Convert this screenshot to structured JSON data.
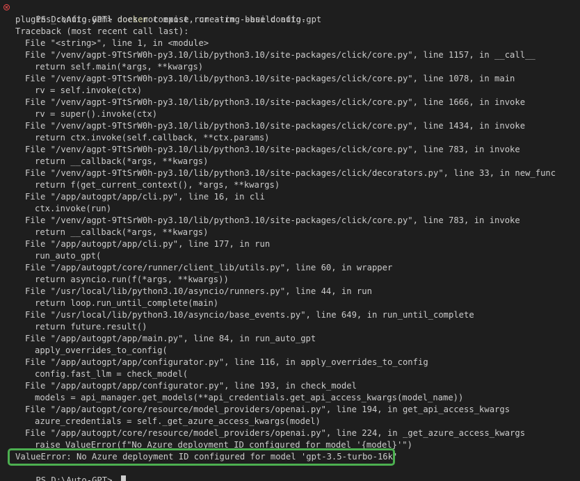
{
  "prompt": {
    "text": "PS D:\\Auto-GPT> ",
    "command": "docker",
    "args": " compose run --rm --build auto-gpt"
  },
  "lines": [
    {
      "indent": 0,
      "text": "plugins_config.yaml does not exist, creating base config."
    },
    {
      "indent": 0,
      "text": "Traceback (most recent call last):"
    },
    {
      "indent": 1,
      "text": "File \"<string>\", line 1, in <module>"
    },
    {
      "indent": 1,
      "text": "File \"/venv/agpt-9TtSrW0h-py3.10/lib/python3.10/site-packages/click/core.py\", line 1157, in __call__"
    },
    {
      "indent": 2,
      "text": "return self.main(*args, **kwargs)"
    },
    {
      "indent": 1,
      "text": "File \"/venv/agpt-9TtSrW0h-py3.10/lib/python3.10/site-packages/click/core.py\", line 1078, in main"
    },
    {
      "indent": 2,
      "text": "rv = self.invoke(ctx)"
    },
    {
      "indent": 1,
      "text": "File \"/venv/agpt-9TtSrW0h-py3.10/lib/python3.10/site-packages/click/core.py\", line 1666, in invoke"
    },
    {
      "indent": 2,
      "text": "rv = super().invoke(ctx)"
    },
    {
      "indent": 1,
      "text": "File \"/venv/agpt-9TtSrW0h-py3.10/lib/python3.10/site-packages/click/core.py\", line 1434, in invoke"
    },
    {
      "indent": 2,
      "text": "return ctx.invoke(self.callback, **ctx.params)"
    },
    {
      "indent": 1,
      "text": "File \"/venv/agpt-9TtSrW0h-py3.10/lib/python3.10/site-packages/click/core.py\", line 783, in invoke"
    },
    {
      "indent": 2,
      "text": "return __callback(*args, **kwargs)"
    },
    {
      "indent": 1,
      "text": "File \"/venv/agpt-9TtSrW0h-py3.10/lib/python3.10/site-packages/click/decorators.py\", line 33, in new_func"
    },
    {
      "indent": 2,
      "text": "return f(get_current_context(), *args, **kwargs)"
    },
    {
      "indent": 1,
      "text": "File \"/app/autogpt/app/cli.py\", line 16, in cli"
    },
    {
      "indent": 2,
      "text": "ctx.invoke(run)"
    },
    {
      "indent": 1,
      "text": "File \"/venv/agpt-9TtSrW0h-py3.10/lib/python3.10/site-packages/click/core.py\", line 783, in invoke"
    },
    {
      "indent": 2,
      "text": "return __callback(*args, **kwargs)"
    },
    {
      "indent": 1,
      "text": "File \"/app/autogpt/app/cli.py\", line 177, in run"
    },
    {
      "indent": 2,
      "text": "run_auto_gpt("
    },
    {
      "indent": 1,
      "text": "File \"/app/autogpt/core/runner/client_lib/utils.py\", line 60, in wrapper"
    },
    {
      "indent": 2,
      "text": "return asyncio.run(f(*args, **kwargs))"
    },
    {
      "indent": 1,
      "text": "File \"/usr/local/lib/python3.10/asyncio/runners.py\", line 44, in run"
    },
    {
      "indent": 2,
      "text": "return loop.run_until_complete(main)"
    },
    {
      "indent": 1,
      "text": "File \"/usr/local/lib/python3.10/asyncio/base_events.py\", line 649, in run_until_complete"
    },
    {
      "indent": 2,
      "text": "return future.result()"
    },
    {
      "indent": 1,
      "text": "File \"/app/autogpt/app/main.py\", line 84, in run_auto_gpt"
    },
    {
      "indent": 2,
      "text": "apply_overrides_to_config("
    },
    {
      "indent": 1,
      "text": "File \"/app/autogpt/app/configurator.py\", line 116, in apply_overrides_to_config"
    },
    {
      "indent": 2,
      "text": "config.fast_llm = check_model("
    },
    {
      "indent": 1,
      "text": "File \"/app/autogpt/app/configurator.py\", line 193, in check_model"
    },
    {
      "indent": 2,
      "text": "models = api_manager.get_models(**api_credentials.get_api_access_kwargs(model_name))"
    },
    {
      "indent": 1,
      "text": "File \"/app/autogpt/core/resource/model_providers/openai.py\", line 194, in get_api_access_kwargs"
    },
    {
      "indent": 2,
      "text": "azure_credentials = self._get_azure_access_kwargs(model)"
    },
    {
      "indent": 1,
      "text": "File \"/app/autogpt/core/resource/model_providers/openai.py\", line 224, in _get_azure_access_kwargs"
    },
    {
      "indent": 2,
      "text": "raise ValueError(f\"No Azure deployment ID configured for model '{model}'\")"
    },
    {
      "indent": 0,
      "text": "ValueError: No Azure deployment ID configured for model 'gpt-3.5-turbo-16k'"
    }
  ],
  "final_prompt": {
    "text": "PS D:\\Auto-GPT> "
  },
  "colors": {
    "background": "#1e1e1e",
    "text": "#cccccc",
    "command": "#dcdcaa",
    "error_status": "#f14c4c",
    "highlight_box": "#4caf50"
  }
}
